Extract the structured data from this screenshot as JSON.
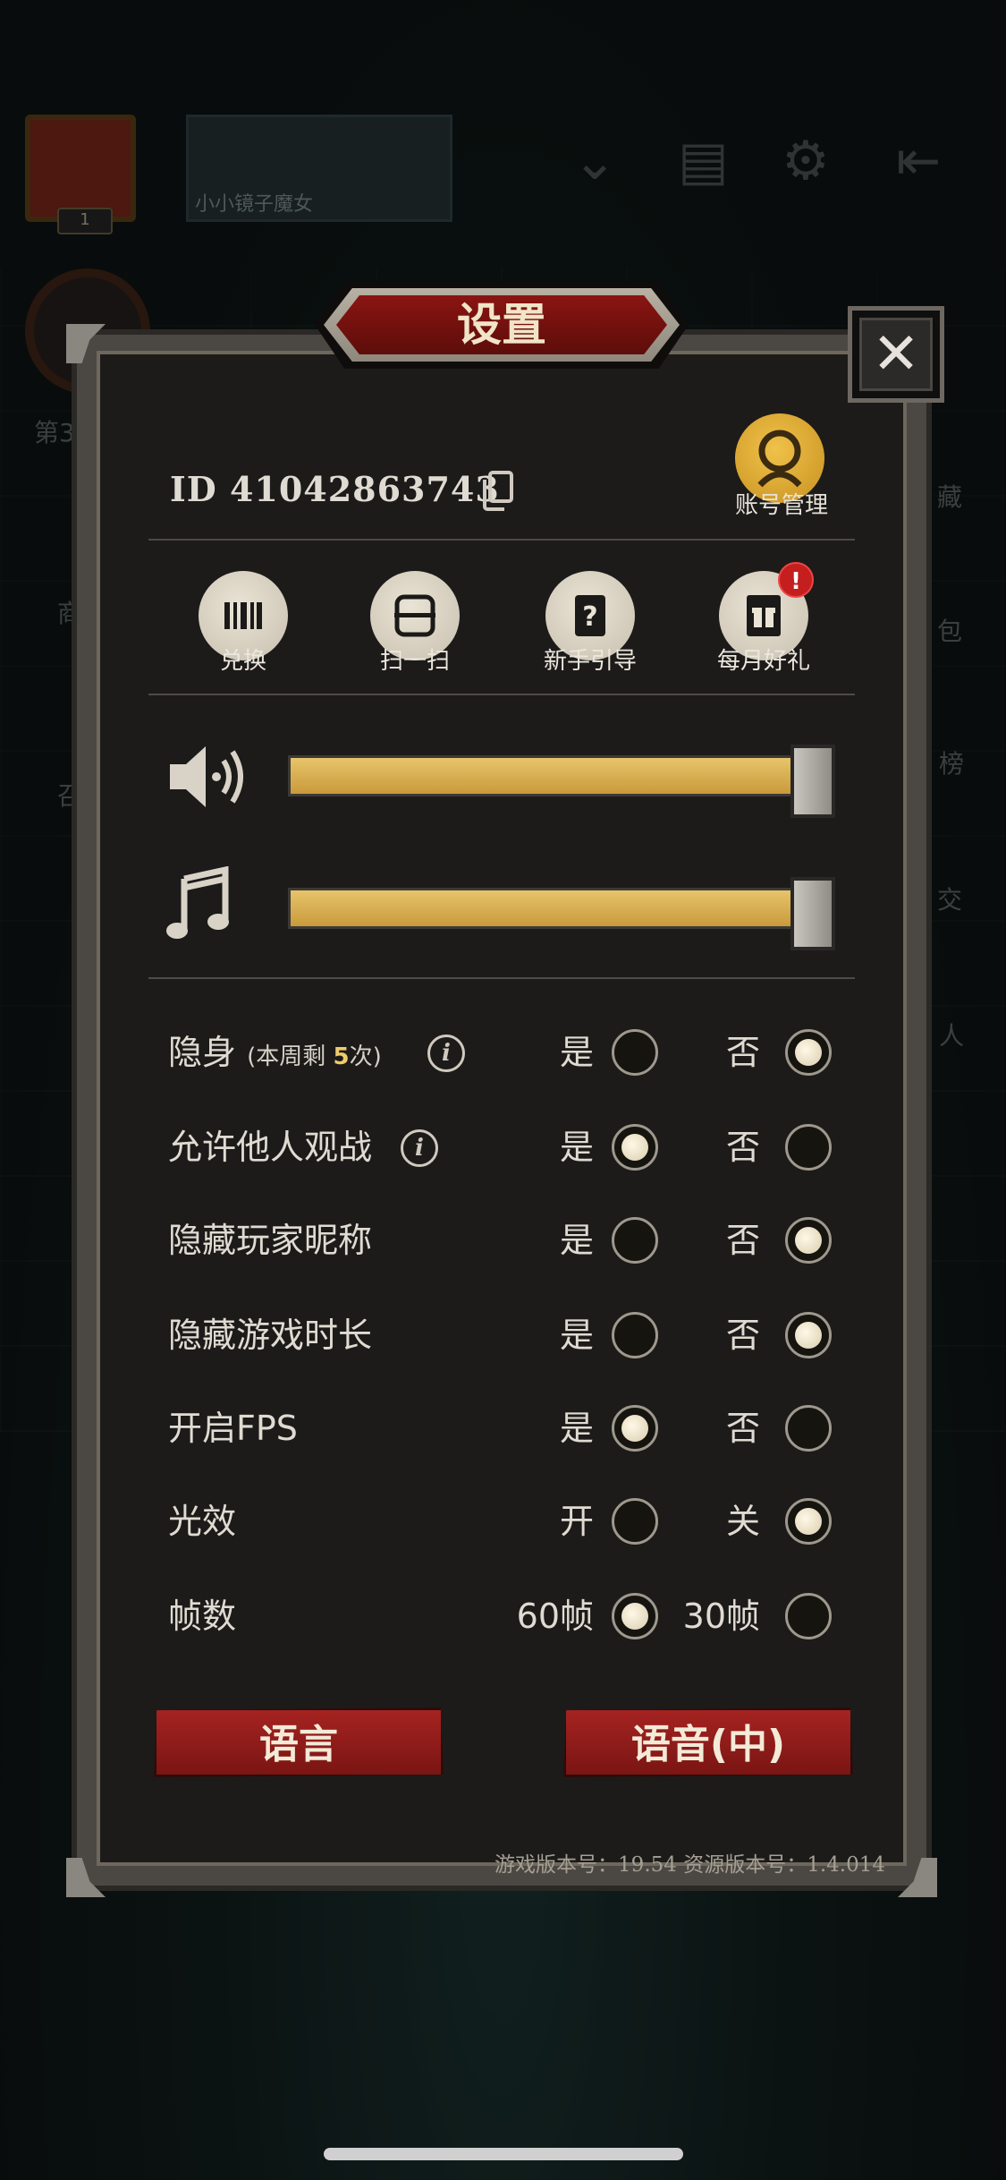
{
  "background": {
    "banner_text": "小小镜子魔女",
    "avatar_level": "1",
    "side_labels": [
      "第3",
      "商",
      "召",
      "藏",
      "包",
      "榜",
      "交",
      "人"
    ]
  },
  "dialog": {
    "title": "设置",
    "close_icon": "close-icon",
    "player_id": "ID 41042863743",
    "account_label": "账号管理",
    "features": [
      {
        "label": "兑换",
        "icon": "barcode-icon"
      },
      {
        "label": "扫一扫",
        "icon": "scan-icon"
      },
      {
        "label": "新手引导",
        "icon": "help-book-icon"
      },
      {
        "label": "每月好礼",
        "icon": "gift-icon",
        "badge": "!"
      }
    ],
    "sound_volume": 1.0,
    "music_volume": 1.0,
    "options": [
      {
        "label": "隐身",
        "sub_prefix": "(本周剩 ",
        "sub_count": "5",
        "sub_suffix": "次)",
        "has_info": true,
        "yes": "是",
        "no": "否",
        "selected": "no"
      },
      {
        "label": "允许他人观战",
        "has_info": true,
        "yes": "是",
        "no": "否",
        "selected": "yes"
      },
      {
        "label": "隐藏玩家昵称",
        "yes": "是",
        "no": "否",
        "selected": "no"
      },
      {
        "label": "隐藏游戏时长",
        "yes": "是",
        "no": "否",
        "selected": "no"
      },
      {
        "label": "开启FPS",
        "yes": "是",
        "no": "否",
        "selected": "yes"
      },
      {
        "label": "光效",
        "yes": "开",
        "no": "关",
        "selected": "no"
      },
      {
        "label": "帧数",
        "yes": "60帧",
        "no": "30帧",
        "selected": "yes"
      }
    ],
    "language_button": "语言",
    "voice_button": "语音(中)",
    "version_text": "游戏版本号：19.54   资源版本号：1.4.014"
  },
  "colors": {
    "accent_gold": "#e7c46a",
    "button_red": "#a52321",
    "panel_bg": "#1c1b1a"
  }
}
